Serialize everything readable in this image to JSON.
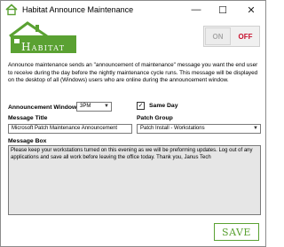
{
  "window": {
    "title": "Habitat Announce Maintenance",
    "icon": "house-icon",
    "controls": {
      "minimize": "—",
      "maximize": "☐",
      "close": "✕"
    }
  },
  "logo": {
    "text": "Habitat",
    "color": "#5aa132"
  },
  "toggle": {
    "on_label": "ON",
    "off_label": "OFF",
    "state": "OFF",
    "off_color": "#c8102e"
  },
  "description": "Announce maintenance sends an \"announcement of maintenance\" message you want the end user to receive during the day before the nightly maintenance cycle runs. This message will be displayed on the desktop of all (Windows) users who are online during the announcement window.",
  "form": {
    "announcement_window": {
      "label": "Announcement Window",
      "value": "3PM"
    },
    "same_day": {
      "label": "Same Day",
      "checked": true,
      "mark": "✓"
    },
    "message_title": {
      "label": "Message Title",
      "value": "Microsoft Patch Maintenance Announcement"
    },
    "patch_group": {
      "label": "Patch Group",
      "value": "Patch Install - Workstations"
    },
    "message_box": {
      "label": "Message Box",
      "value": "Please keep your workstations turned on this evening as we will be preforming updates. Log out of any applications and save all work before leaving the office today.  Thank you,  Janus Tech"
    }
  },
  "save_label": "SAVE",
  "accent_color": "#5aa132"
}
